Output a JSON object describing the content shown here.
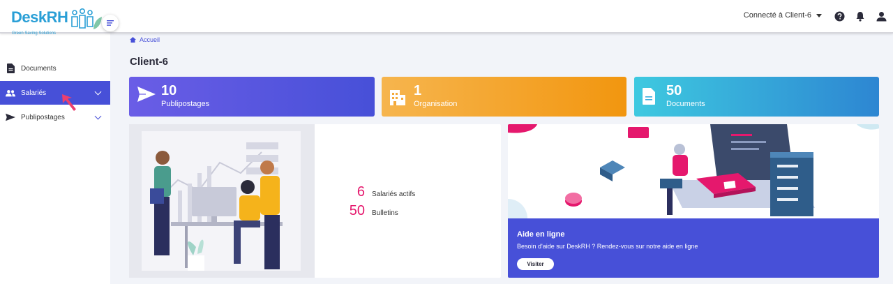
{
  "brand": {
    "name": "DeskRH",
    "tagline": "Green Saving Solutions",
    "color": "#2a9fd6"
  },
  "header": {
    "user_label": "Connecté à Client-6",
    "icons": [
      "menu-icon",
      "help-icon",
      "bell-icon",
      "user-icon"
    ]
  },
  "sidebar": {
    "items": [
      {
        "label": "Documents",
        "icon": "document-icon",
        "active": false
      },
      {
        "label": "Salariés",
        "icon": "people-icon",
        "active": true
      },
      {
        "label": "Publipostages",
        "icon": "send-icon",
        "active": false
      }
    ],
    "active_color": "#4750d8"
  },
  "main": {
    "breadcrumb": "Accueil",
    "title": "Client-6",
    "stats": [
      {
        "value": "10",
        "label": "Publipostages",
        "icon": "send-icon",
        "gradient": [
          "#6a5de6",
          "#4750d8"
        ]
      },
      {
        "value": "1",
        "label": "Organisation",
        "icon": "building-icon",
        "gradient": [
          "#f6b54e",
          "#f2960f"
        ]
      },
      {
        "value": "50",
        "label": "Documents",
        "icon": "document-icon",
        "gradient": [
          "#3ec9e0",
          "#2d86d2"
        ]
      }
    ],
    "kpis": [
      {
        "value": "6",
        "label": "Salariés actifs"
      },
      {
        "value": "50",
        "label": "Bulletins"
      }
    ],
    "accent": "#e5186d",
    "help": {
      "title": "Aide en ligne",
      "text": "Besoin d'aide sur DeskRH ? Rendez-vous sur notre aide en ligne",
      "button": "Visiter"
    }
  }
}
